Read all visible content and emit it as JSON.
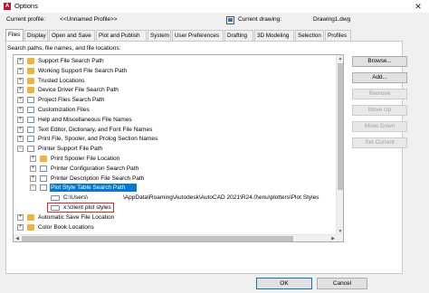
{
  "window": {
    "title": "Options",
    "app_icon_letter": "A",
    "close_glyph": "✕"
  },
  "profile": {
    "current_profile_label": "Current profile:",
    "current_profile_value": "<<Unnamed Profile>>",
    "current_drawing_label": "Current drawing:",
    "current_drawing_value": "Drawing1.dwg"
  },
  "tabs": [
    {
      "label": "Files",
      "active": true
    },
    {
      "label": "Display",
      "active": false
    },
    {
      "label": "Open and Save",
      "active": false
    },
    {
      "label": "Plot and Publish",
      "active": false
    },
    {
      "label": "System",
      "active": false
    },
    {
      "label": "User Preferences",
      "active": false
    },
    {
      "label": "Drafting",
      "active": false
    },
    {
      "label": "3D Modeling",
      "active": false
    },
    {
      "label": "Selection",
      "active": false
    },
    {
      "label": "Profiles",
      "active": false
    }
  ],
  "search_label": "Search paths, file names, and file locations:",
  "tree": {
    "items": [
      {
        "label": "Support File Search Path",
        "icon": "folder-icon",
        "expander": "+"
      },
      {
        "label": "Working Support File Search Path",
        "icon": "folder-icon",
        "expander": "+"
      },
      {
        "label": "Trusted Locations",
        "icon": "folder-icon",
        "expander": "+"
      },
      {
        "label": "Device Driver File Search Path",
        "icon": "folder-icon",
        "expander": "+"
      },
      {
        "label": "Project Files Search Path",
        "icon": "document-icon",
        "expander": "+"
      },
      {
        "label": "Customization Files",
        "icon": "document-icon",
        "expander": "+"
      },
      {
        "label": "Help and Miscellaneous File Names",
        "icon": "document-icon",
        "expander": "+"
      },
      {
        "label": "Text Editor, Dictionary, and Font File Names",
        "icon": "document-icon",
        "expander": "+"
      },
      {
        "label": "Print File, Spooler, and Prolog Section Names",
        "icon": "document-icon",
        "expander": "+"
      },
      {
        "label": "Printer Support File Path",
        "icon": "document-icon",
        "expander": "−"
      },
      {
        "label": "Print Spooler File Location",
        "icon": "folder-icon",
        "expander": "+"
      },
      {
        "label": "Printer Configuration Search Path",
        "icon": "document-icon",
        "expander": "+"
      },
      {
        "label": "Printer Description File Search Path",
        "icon": "document-icon",
        "expander": "+"
      },
      {
        "label": "Plot Style Table Search Path",
        "icon": "document-icon",
        "expander": "−",
        "selected": true
      },
      {
        "label": "C:\\Users\\",
        "label2": "\\AppData\\Roaming\\Autodesk\\AutoCAD 2021\\R24.0\\enu\\plotters\\Plot Styles",
        "icon": "path-icon"
      },
      {
        "label": "x:\\client plot styles",
        "icon": "path-icon",
        "highlighted": true
      },
      {
        "label": "Automatic Save File Location",
        "icon": "folder-icon",
        "expander": "+"
      },
      {
        "label": "Color Book Locations",
        "icon": "folder-icon",
        "expander": "+"
      }
    ]
  },
  "side_buttons": [
    {
      "label": "Browse...",
      "enabled": true
    },
    {
      "label": "Add...",
      "enabled": true
    },
    {
      "label": "Remove",
      "enabled": false
    },
    {
      "label": "Move Up",
      "enabled": false
    },
    {
      "label": "Move Down",
      "enabled": false
    },
    {
      "label": "Set Current",
      "enabled": false
    }
  ],
  "bottom_buttons": {
    "ok": "OK",
    "cancel": "Cancel"
  },
  "colors": {
    "selection": "#0078d7",
    "highlight_box": "#e0262b",
    "folder": "#f0b43c"
  }
}
